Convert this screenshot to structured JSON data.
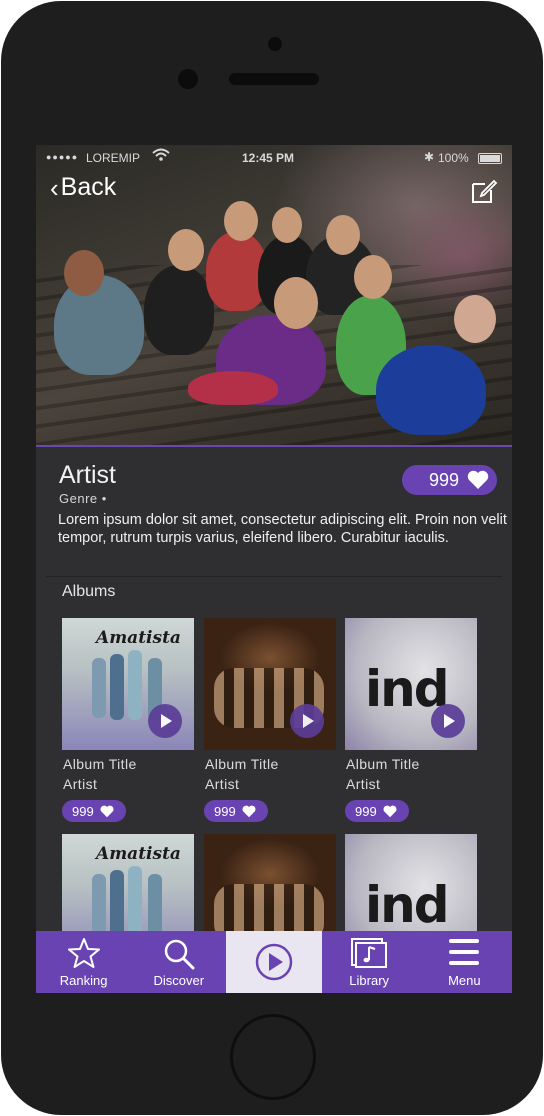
{
  "status_bar": {
    "carrier": "LOREMIP",
    "time": "12:45 PM",
    "battery": "100%"
  },
  "nav": {
    "back_label": "Back"
  },
  "artist": {
    "name": "Artist",
    "genre": "Genre •",
    "description": "Lorem ipsum dolor sit amet, consectetur adipiscing elit. Proin non velit tempor, rutrum turpis varius, eleifend libero. Curabitur iaculis.",
    "likes": "999"
  },
  "albums_section": {
    "title": "Albums"
  },
  "albums": [
    {
      "title": "Album Title",
      "artist": "Artist",
      "likes": "999",
      "cover_text": "Amatista"
    },
    {
      "title": "Album Title",
      "artist": "Artist",
      "likes": "999",
      "cover_text": ""
    },
    {
      "title": "Album Title",
      "artist": "Artist",
      "likes": "999",
      "cover_text": "ind"
    },
    {
      "title": "",
      "artist": "",
      "likes": "",
      "cover_text": "Amatista"
    },
    {
      "title": "",
      "artist": "",
      "likes": "",
      "cover_text": ""
    },
    {
      "title": "",
      "artist": "",
      "likes": "",
      "cover_text": "ind"
    }
  ],
  "tabbar": {
    "items": [
      {
        "label": "Ranking",
        "icon": "star-icon"
      },
      {
        "label": "Discover",
        "icon": "search-icon"
      },
      {
        "label": "",
        "icon": "play-icon",
        "active": true
      },
      {
        "label": "Library",
        "icon": "music-library-icon"
      },
      {
        "label": "Menu",
        "icon": "hamburger-icon"
      }
    ]
  },
  "colors": {
    "accent": "#6a43b3",
    "background": "#2f2f31",
    "active_tab": "#e9e5f1"
  }
}
